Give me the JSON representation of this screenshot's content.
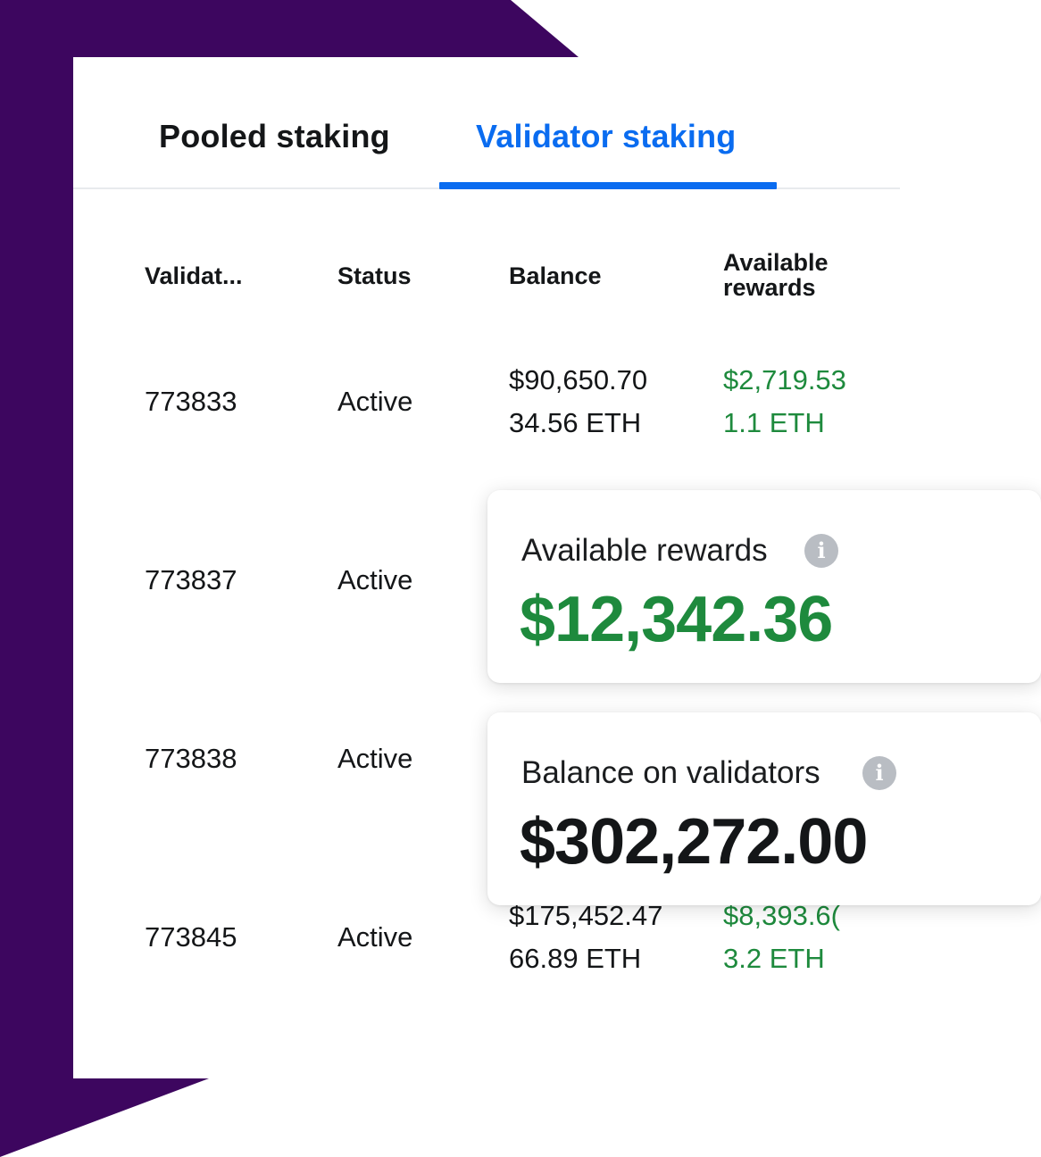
{
  "tabs": {
    "pooled_label": "Pooled staking",
    "validator_label": "Validator staking",
    "active_tab": "Validator staking"
  },
  "table": {
    "headers": {
      "validator": "Validat...",
      "status": "Status",
      "balance": "Balance",
      "rewards_line1": "Available",
      "rewards_line2": "rewards"
    },
    "rows": [
      {
        "validator": "773833",
        "status": "Active",
        "balance_usd": "$90,650.70",
        "balance_eth": "34.56 ETH",
        "rewards_usd": "$2,719.53",
        "rewards_eth": "1.1 ETH"
      },
      {
        "validator": "773837",
        "status": "Active"
      },
      {
        "validator": "773838",
        "status": "Active"
      },
      {
        "validator": "773845",
        "status": "Active",
        "balance_usd": "$175,452.47",
        "balance_eth": "66.89 ETH",
        "rewards_usd": "$8,393.6(",
        "rewards_eth": "3.2 ETH"
      }
    ]
  },
  "summary": {
    "rewards_label": "Available rewards",
    "rewards_value": "$12,342.36",
    "balance_label": "Balance on validators",
    "balance_value": "$302,272.00",
    "info_glyph": "i"
  },
  "colors": {
    "brand_purple": "#3d065f",
    "accent_blue": "#0a6cf0",
    "positive_green": "#1e8a3d"
  }
}
